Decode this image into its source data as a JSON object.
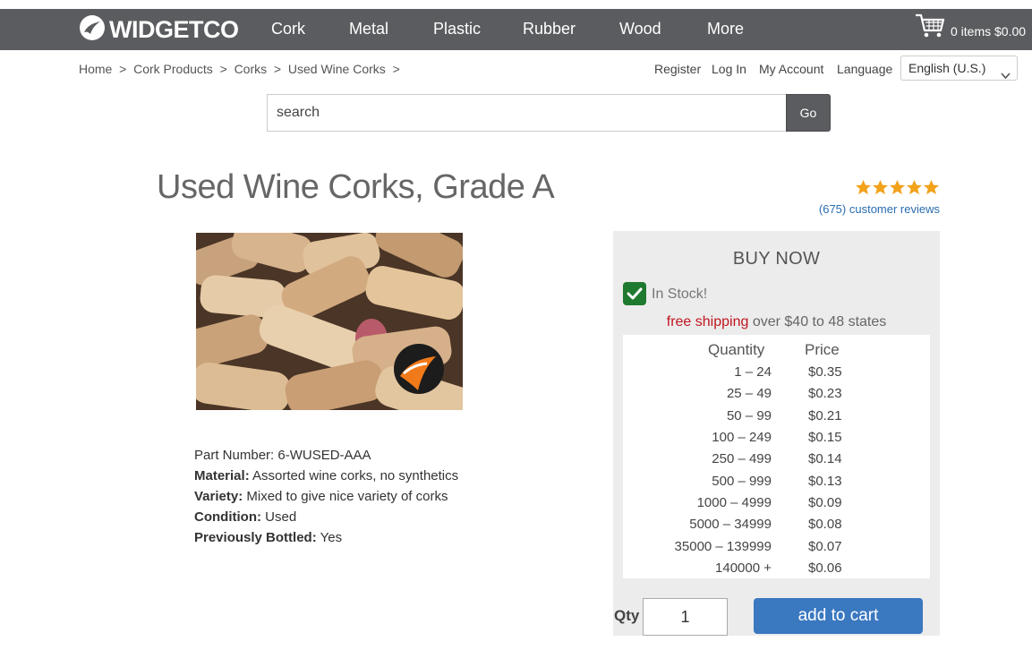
{
  "brand": {
    "name": "WIDGETCO",
    "logo_icon": "swoosh-logo-icon"
  },
  "nav": {
    "items": [
      {
        "label": "Cork"
      },
      {
        "label": "Metal"
      },
      {
        "label": "Plastic"
      },
      {
        "label": "Rubber"
      },
      {
        "label": "Wood"
      },
      {
        "label": "More"
      }
    ]
  },
  "cart": {
    "icon": "cart-icon",
    "label": "0 items $0.00"
  },
  "breadcrumb": {
    "items": [
      {
        "label": "Home"
      },
      {
        "label": "Cork Products"
      },
      {
        "label": "Corks"
      },
      {
        "label": "Used Wine Corks"
      }
    ],
    "separator": ">"
  },
  "account": {
    "register": "Register",
    "login": "Log In",
    "my_account": "My Account",
    "language_label": "Language",
    "language_value": "English (U.S.)"
  },
  "search": {
    "placeholder": "search",
    "go_label": "Go"
  },
  "product": {
    "title": "Used Wine Corks, Grade A",
    "rating": 5,
    "reviews": "(675) customer reviews",
    "image_icon": "wine-corks-photo",
    "specs": {
      "part_number": "Part Number: 6-WUSED-AAA",
      "material_label": "Material:",
      "material_value": " Assorted wine corks, no synthetics",
      "variety_label": "Variety:",
      "variety_value": " Mixed to give nice variety of corks",
      "condition_label": "Condition:",
      "condition_value": " Used",
      "bottled_label": "Previously Bottled:",
      "bottled_value": " Yes"
    }
  },
  "buy_box": {
    "title": "BUY NOW",
    "stock_icon": "check-icon",
    "stock": "In Stock!",
    "shipping_highlight": "free shipping",
    "shipping_rest": " over $40 to 48 states",
    "table": {
      "headers": {
        "quantity": "Quantity",
        "price": "Price"
      },
      "rows": [
        {
          "qty": "1 – 24",
          "price": "$0.35"
        },
        {
          "qty": "25 – 49",
          "price": "$0.23"
        },
        {
          "qty": "50 – 99",
          "price": "$0.21"
        },
        {
          "qty": "100 – 249",
          "price": "$0.15"
        },
        {
          "qty": "250 – 499",
          "price": "$0.14"
        },
        {
          "qty": "500 – 999",
          "price": "$0.13"
        },
        {
          "qty": "1000 – 4999",
          "price": "$0.09"
        },
        {
          "qty": "5000 – 34999",
          "price": "$0.08"
        },
        {
          "qty": "35000 – 139999",
          "price": "$0.07"
        },
        {
          "qty": "140000 +",
          "price": "$0.06"
        }
      ]
    },
    "qty_label": "Qty",
    "qty_value": "1",
    "add_to_cart": "add to cart"
  },
  "colors": {
    "topbar": "#5b5c5f",
    "star": "#f2a21b",
    "link": "#2a6cb0",
    "free_shipping": "#c0161f",
    "in_stock": "#1e7a2e",
    "add_button": "#3a78c0"
  }
}
